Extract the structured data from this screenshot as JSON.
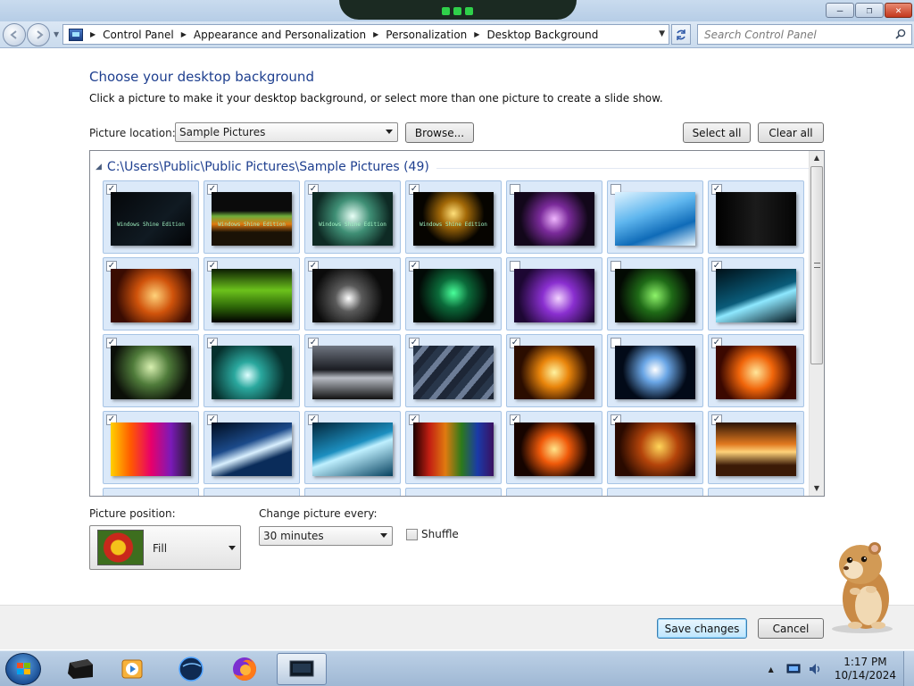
{
  "window": {
    "minimize_glyph": "—",
    "maximize_glyph": "❐",
    "close_glyph": "✕"
  },
  "address": {
    "breadcrumbs": [
      "Control Panel",
      "Appearance and Personalization",
      "Personalization",
      "Desktop Background"
    ],
    "search_placeholder": "Search Control Panel"
  },
  "main": {
    "heading": "Choose your desktop background",
    "subtitle": "Click a picture to make it your desktop background, or select more than one picture to create a slide show.",
    "picture_location_label": "Picture location:",
    "picture_location_value": "Sample Pictures",
    "browse_label": "Browse...",
    "select_all_label": "Select all",
    "clear_all_label": "Clear all",
    "group_header": "C:\\Users\\Public\\Public Pictures\\Sample Pictures (49)",
    "tiles": [
      {
        "checked": true,
        "bg": "linear-gradient(135deg,#05070a,#101a22 60%,#020305)",
        "caption": "Windows Shine Edition"
      },
      {
        "checked": true,
        "bg": "linear-gradient(180deg,#0b0b0b 0 35%,#6fae3b 45%,#e07a10 60%,#1a1206 75%)",
        "caption": "Windows Shine Edition"
      },
      {
        "checked": true,
        "bg": "radial-gradient(circle at 50% 45%,#e8fff6,#3f8f75 35%,#0e2a24 75%)",
        "caption": "Windows Shine Edition"
      },
      {
        "checked": true,
        "bg": "radial-gradient(circle at 50% 40%,#ffe07a,#a46a08 25%,#060400 60%)",
        "caption": "Windows Shine Edition"
      },
      {
        "checked": false,
        "bg": "radial-gradient(circle at 50% 50%,#f0b6ff,#7a2a9a 30%,#12071a 70%)",
        "caption": ""
      },
      {
        "checked": false,
        "bg": "linear-gradient(160deg,#dff3ff,#5fb6ee 40%,#0f6bb8 70%,#e8f6ff)",
        "caption": ""
      },
      {
        "checked": true,
        "bg": "linear-gradient(90deg,#000,#1b1b1b 50%,#050505)",
        "caption": ""
      },
      {
        "checked": true,
        "bg": "radial-gradient(circle at 55% 50%,#ffd27a,#d0530b 35%,#3a0c02 75%)",
        "caption": ""
      },
      {
        "checked": true,
        "bg": "linear-gradient(180deg,#0c1d02,#6cc21c 40%,#2f6a08 70%,#000)",
        "caption": ""
      },
      {
        "checked": true,
        "bg": "radial-gradient(circle at 45% 55%,#ffffff,#5a5a5a 25%,#0b0b0b 65%)",
        "caption": ""
      },
      {
        "checked": true,
        "bg": "radial-gradient(circle at 50% 45%,#49ff9a,#0b6b3a 30%,#020a06 70%)",
        "caption": ""
      },
      {
        "checked": false,
        "bg": "radial-gradient(circle at 55% 55%,#f3d3ff,#8a2fd0 30%,#1d0733 75%)",
        "caption": ""
      },
      {
        "checked": false,
        "bg": "radial-gradient(circle at 50% 50%,#8ef36a,#1f6a17 35%,#030a03 75%)",
        "caption": ""
      },
      {
        "checked": true,
        "bg": "linear-gradient(160deg,#001018,#0a5c7a 50%,#8ee8ff 60%,#001018)",
        "caption": ""
      },
      {
        "checked": true,
        "bg": "radial-gradient(circle at 50% 40%,#d8f0b0,#4f7b3a 35%,#0b0f08 75%)",
        "caption": ""
      },
      {
        "checked": true,
        "bg": "radial-gradient(circle at 45% 55%,#dfffff,#2aa89e 25%,#06302d 70%)",
        "caption": ""
      },
      {
        "checked": true,
        "bg": "linear-gradient(180deg,#6f7580,#1a1c22 45%,#b8bcc4 60%,#111)",
        "caption": ""
      },
      {
        "checked": true,
        "bg": "repeating-linear-gradient(130deg,#28364a 0 8px,#6c7c96 8px 14px,#1d2636 14px 22px)",
        "caption": ""
      },
      {
        "checked": true,
        "bg": "radial-gradient(circle at 50% 50%,#fff3a0,#e9850b 30%,#2b0d00 70%)",
        "caption": ""
      },
      {
        "checked": false,
        "bg": "radial-gradient(circle at 50% 45%,#ffffff,#6aa6e6 25%,#020a18 65%)",
        "caption": ""
      },
      {
        "checked": true,
        "bg": "radial-gradient(circle at 50% 50%,#ffe69a,#f0650a 35%,#3b0800 75%)",
        "caption": ""
      },
      {
        "checked": true,
        "bg": "linear-gradient(90deg,#ffd100,#ff5a00,#e8006a,#7b1ab8,#1c1c1c)",
        "caption": ""
      },
      {
        "checked": true,
        "bg": "linear-gradient(160deg,#000c1e,#1b4a8a 40%,#d9f0ff 55%,#0a2c5a 70%)",
        "caption": ""
      },
      {
        "checked": true,
        "bg": "linear-gradient(160deg,#03263a,#1c8fc0 45%,#bff0ff 55%,#06415f)",
        "caption": ""
      },
      {
        "checked": true,
        "bg": "linear-gradient(90deg,#1a0000,#c21e12,#e07a10,#2d7a1a,#1a3aa8,#3a1060)",
        "caption": ""
      },
      {
        "checked": true,
        "bg": "radial-gradient(circle at 50% 50%,#ffe58a,#f05a0a 30%,#160400 70%)",
        "caption": ""
      },
      {
        "checked": true,
        "bg": "radial-gradient(circle at 55% 45%,#ffd65a,#b4440a 35%,#2a0a00 75%)",
        "caption": ""
      },
      {
        "checked": true,
        "bg": "linear-gradient(180deg,#2b1406,#e0781e 40%,#ffd27a 55%,#3b1a06 80%)",
        "caption": ""
      }
    ],
    "picture_position_label": "Picture position:",
    "picture_position_value": "Fill",
    "change_every_label": "Change picture every:",
    "change_every_value": "30 minutes",
    "shuffle_label": "Shuffle",
    "save_label": "Save changes",
    "cancel_label": "Cancel"
  },
  "taskbar": {
    "time": "1:17 PM",
    "date": "10/14/2024",
    "tray_expand_glyph": "▲"
  }
}
